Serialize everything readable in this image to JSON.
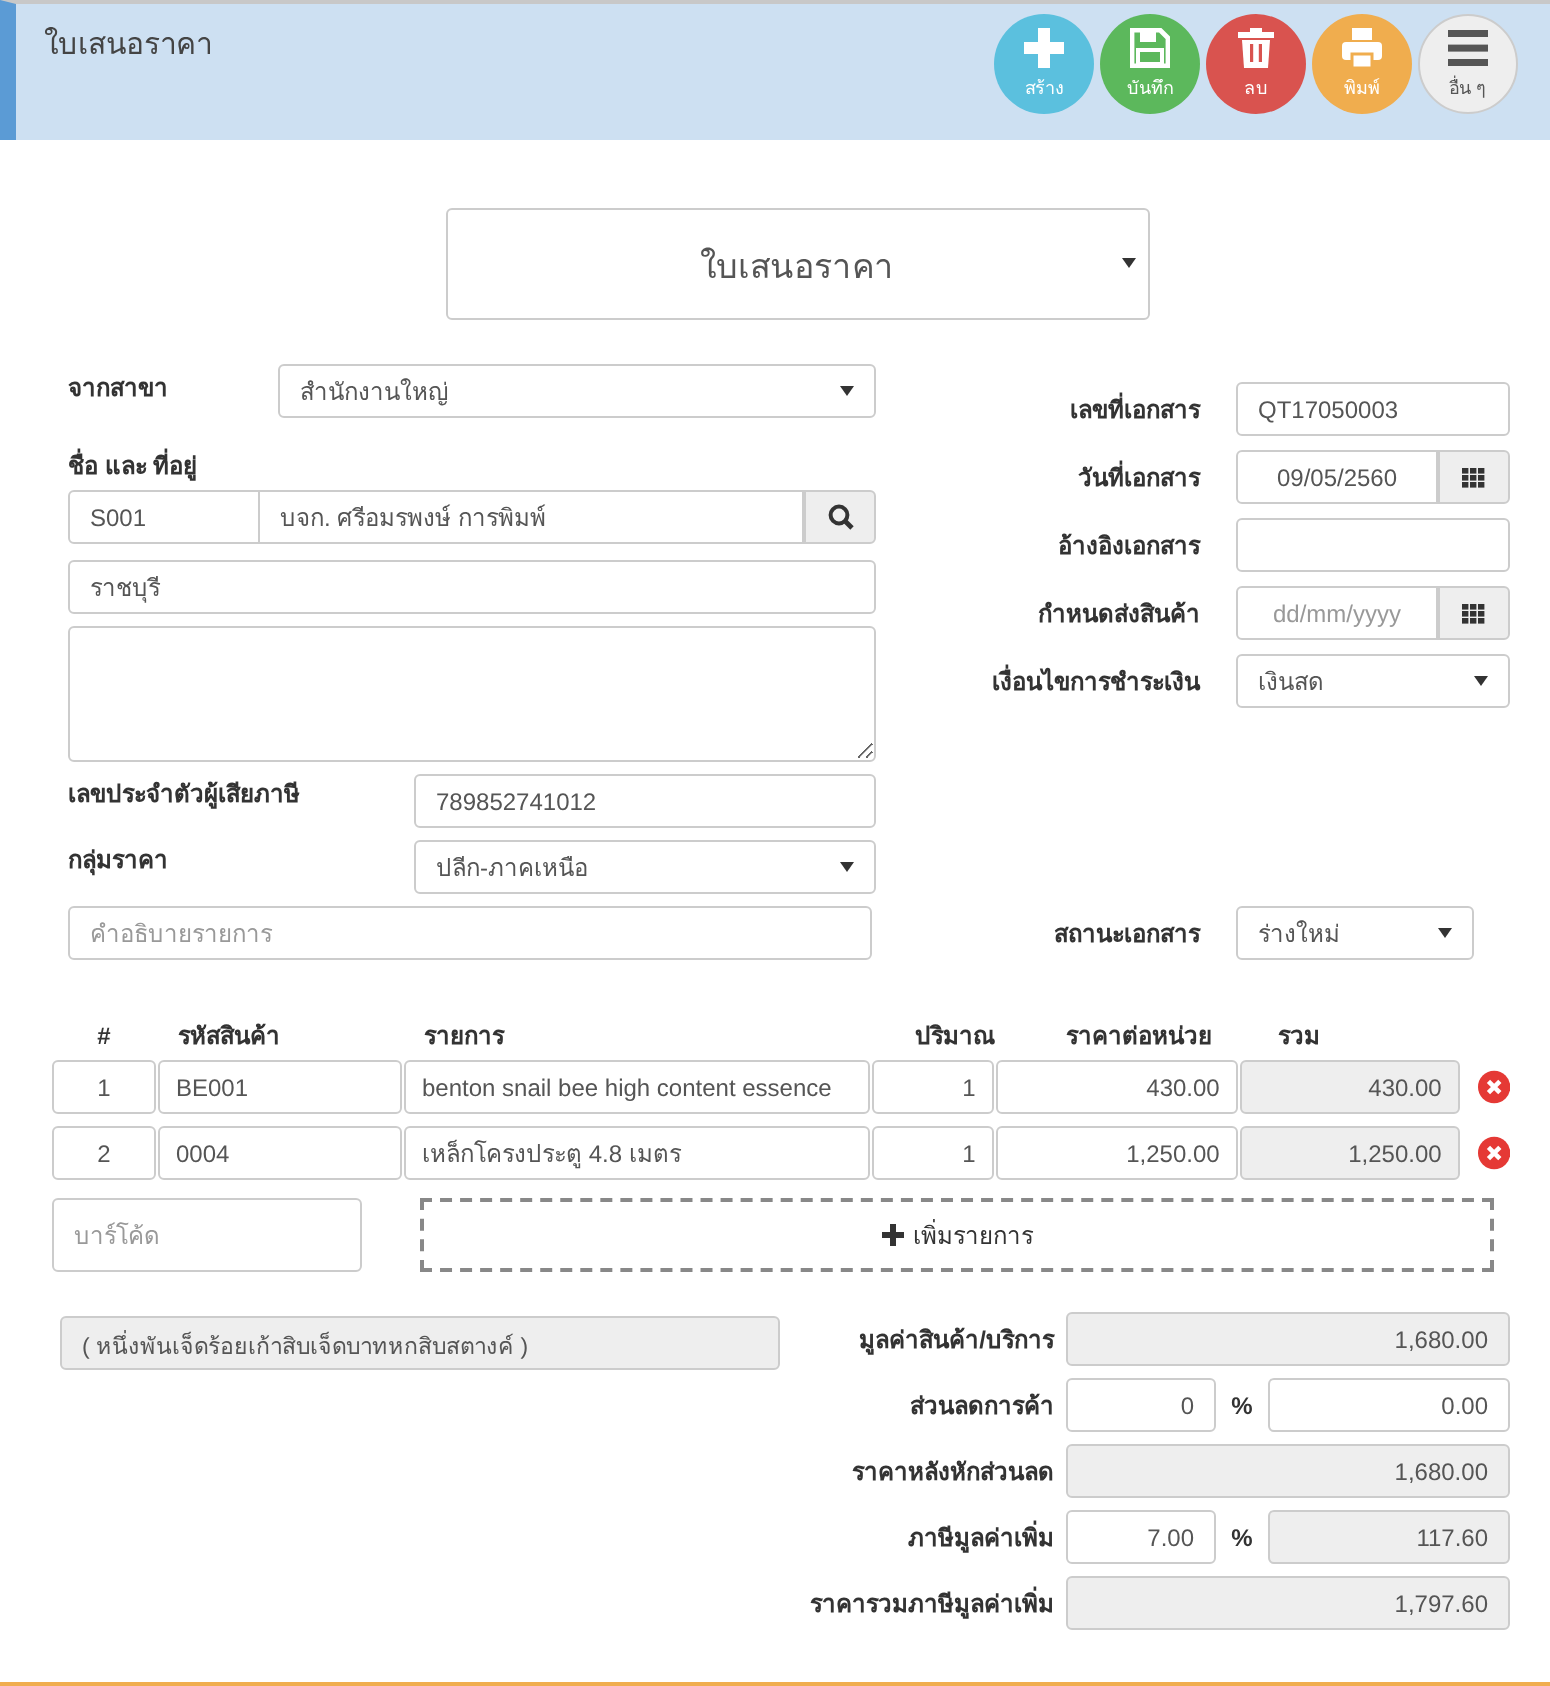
{
  "header": {
    "title": "ใบเสนอราคา",
    "buttons": [
      {
        "kind": "create",
        "label": "สร้าง"
      },
      {
        "kind": "save",
        "label": "บันทึก"
      },
      {
        "kind": "delete",
        "label": "ลบ"
      },
      {
        "kind": "print",
        "label": "พิมพ์"
      },
      {
        "kind": "more",
        "label": "อื่น ๆ"
      }
    ]
  },
  "doc_type": {
    "value": "ใบเสนอราคา"
  },
  "left": {
    "branch": {
      "label": "จากสาขา",
      "value": "สำนักงานใหญ่"
    },
    "name_label": "ชื่อ และ ที่อยู่",
    "customer_code": "S001",
    "customer_name": "บจก. ศรีอมรพงษ์ การพิมพ์",
    "address_line": "ราชบุรี",
    "tax_id": {
      "label": "เลขประจำตัวผู้เสียภาษี",
      "value": "789852741012"
    },
    "price_group": {
      "label": "กลุ่มราคา",
      "value": "ปลีก-ภาคเหนือ"
    },
    "description": {
      "placeholder": "คำอธิบายรายการ"
    }
  },
  "right": {
    "fields": [
      {
        "kind": "text",
        "label": "เลขที่เอกสาร",
        "value": "QT17050003"
      },
      {
        "kind": "date",
        "label": "วันที่เอกสาร",
        "value": "09/05/2560"
      },
      {
        "kind": "text",
        "label": "อ้างอิงเอกสาร"
      },
      {
        "kind": "date",
        "label": "กำหนดส่งสินค้า",
        "placeholder": "dd/mm/yyyy"
      },
      {
        "kind": "select",
        "label": "เงื่อนไขการชำระเงิน",
        "value": "เงินสด"
      }
    ],
    "status": {
      "label": "สถานะเอกสาร",
      "value": "ร่างใหม่"
    }
  },
  "table": {
    "columns": [
      "#",
      "รหัสสินค้า",
      "รายการ",
      "ปริมาณ",
      "ราคาต่อหน่วย",
      "รวม"
    ],
    "rows": [
      {
        "no": "1",
        "code": "BE001",
        "name": "benton snail bee high content essence",
        "qty": "1",
        "price": "430.00",
        "total": "430.00"
      },
      {
        "no": "2",
        "code": "0004",
        "name": "เหล็กโครงประตู 4.8 เมตร",
        "qty": "1",
        "price": "1,250.00",
        "total": "1,250.00"
      }
    ]
  },
  "barcode": {
    "placeholder": "บาร์โค้ด"
  },
  "add_item": {
    "label": "เพิ่มรายการ"
  },
  "amount_in_words": "( หนึ่งพันเจ็ดร้อยเก้าสิบเจ็ดบาทหกสิบสตางค์ )",
  "totals": [
    {
      "kind": "readonly",
      "label": "มูลค่าสินค้า/บริการ",
      "value": "1,680.00"
    },
    {
      "kind": "percent",
      "label": "ส่วนลดการค้า",
      "rate": "0",
      "unit": "%",
      "value": "0.00",
      "value_readonly": false
    },
    {
      "kind": "readonly",
      "label": "ราคาหลังหักส่วนลด",
      "value": "1,680.00"
    },
    {
      "kind": "percent",
      "label": "ภาษีมูลค่าเพิ่ม",
      "rate": "7.00",
      "unit": "%",
      "value": "117.60",
      "value_readonly": true
    },
    {
      "kind": "readonly",
      "label": "ราคารวมภาษีมูลค่าเพิ่ม",
      "value": "1,797.60"
    }
  ]
}
